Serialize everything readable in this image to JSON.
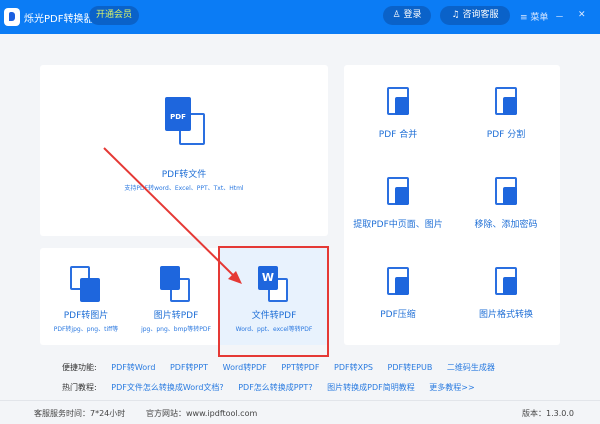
{
  "header": {
    "title": "烁光PDF转换器",
    "vip": "开通会员",
    "login": "登录",
    "service": "咨询客服",
    "menu": "菜单",
    "minimize": "－",
    "close": "✕"
  },
  "main_tile": {
    "name": "PDF转文件",
    "sub": "支持PDF转word、Excel、PPT、Txt、Html",
    "badge": "PDF"
  },
  "tiles": [
    {
      "name": "PDF转图片",
      "sub": "PDF转jpg、png、tiff等"
    },
    {
      "name": "图片转PDF",
      "sub": "jpg、png、bmp等转PDF"
    },
    {
      "name": "文件转PDF",
      "sub": "Word、ppt、excel等转PDF",
      "badge": "W"
    }
  ],
  "right_tiles": [
    "PDF 合并",
    "PDF 分割",
    "提取PDF中页面、图片",
    "移除、添加密码",
    "PDF压缩",
    "图片格式转换"
  ],
  "quick": {
    "label": "便捷功能:",
    "links": [
      "PDF转Word",
      "PDF转PPT",
      "Word转PDF",
      "PPT转PDF",
      "PDF转XPS",
      "PDF转EPUB",
      "二维码生成器"
    ]
  },
  "hot": {
    "label": "热门教程:",
    "links": [
      "PDF文件怎么转换成Word文档?",
      "PDF怎么转换成PPT?",
      "图片转换成PDF简明教程",
      "更多教程>>"
    ]
  },
  "footer": {
    "hours": "客服服务时间：7*24小时",
    "site": "官方网站：www.ipdftool.com",
    "version": "版本：1.3.0.0"
  }
}
